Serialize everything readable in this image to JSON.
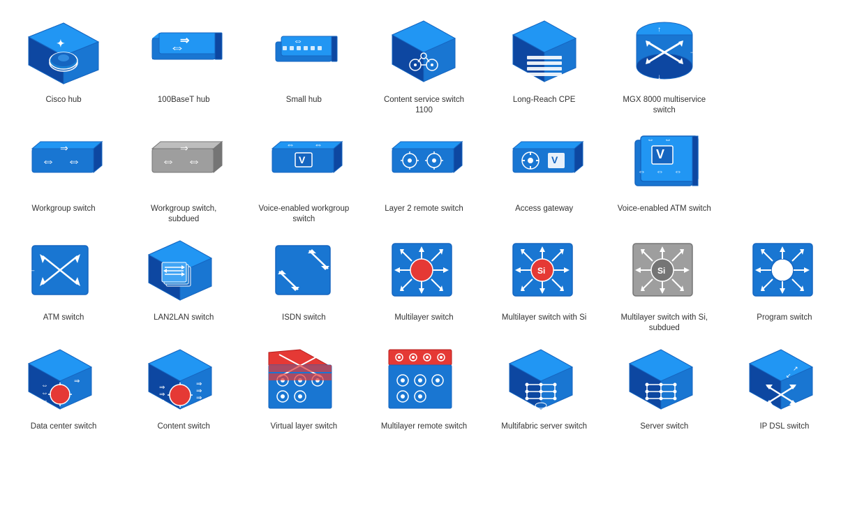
{
  "items": [
    {
      "id": "cisco-hub",
      "label": "Cisco hub",
      "type": "cisco-hub"
    },
    {
      "id": "100baset-hub",
      "label": "100BaseT hub",
      "type": "100baset-hub"
    },
    {
      "id": "small-hub",
      "label": "Small hub",
      "type": "small-hub"
    },
    {
      "id": "content-service-switch-1100",
      "label": "Content service switch 1100",
      "type": "content-service-switch"
    },
    {
      "id": "long-reach-cpe",
      "label": "Long-Reach CPE",
      "type": "long-reach-cpe"
    },
    {
      "id": "mgx-8000",
      "label": "MGX 8000 multiservice switch",
      "type": "mgx-8000"
    },
    {
      "id": "spacer1",
      "label": "",
      "type": "empty"
    },
    {
      "id": "workgroup-switch",
      "label": "Workgroup switch",
      "type": "workgroup-switch"
    },
    {
      "id": "workgroup-switch-subdued",
      "label": "Workgroup switch, subdued",
      "type": "workgroup-switch-subdued"
    },
    {
      "id": "voice-workgroup-switch",
      "label": "Voice-enabled workgroup switch",
      "type": "voice-workgroup-switch"
    },
    {
      "id": "layer2-remote-switch",
      "label": "Layer 2 remote switch",
      "type": "layer2-remote-switch"
    },
    {
      "id": "access-gateway",
      "label": "Access gateway",
      "type": "access-gateway"
    },
    {
      "id": "voice-atm-switch",
      "label": "Voice-enabled ATM switch",
      "type": "voice-atm-switch"
    },
    {
      "id": "spacer2",
      "label": "",
      "type": "empty"
    },
    {
      "id": "atm-switch",
      "label": "ATM switch",
      "type": "atm-switch"
    },
    {
      "id": "lan2lan-switch",
      "label": "LAN2LAN switch",
      "type": "lan2lan-switch"
    },
    {
      "id": "isdn-switch",
      "label": "ISDN switch",
      "type": "isdn-switch"
    },
    {
      "id": "multilayer-switch",
      "label": "Multilayer switch",
      "type": "multilayer-switch"
    },
    {
      "id": "multilayer-switch-si",
      "label": "Multilayer switch with Si",
      "type": "multilayer-switch-si"
    },
    {
      "id": "multilayer-switch-si-subdued",
      "label": "Multilayer switch with Si, subdued",
      "type": "multilayer-switch-si-subdued"
    },
    {
      "id": "program-switch",
      "label": "Program switch",
      "type": "program-switch"
    },
    {
      "id": "data-center-switch",
      "label": "Data center switch",
      "type": "data-center-switch"
    },
    {
      "id": "content-switch",
      "label": "Content switch",
      "type": "content-switch"
    },
    {
      "id": "virtual-layer-switch",
      "label": "Virtual layer switch",
      "type": "virtual-layer-switch"
    },
    {
      "id": "multilayer-remote-switch",
      "label": "Multilayer remote switch",
      "type": "multilayer-remote-switch"
    },
    {
      "id": "multifabric-server-switch",
      "label": "Multifabric server switch",
      "type": "multifabric-server-switch"
    },
    {
      "id": "server-switch",
      "label": "Server switch",
      "type": "server-switch"
    },
    {
      "id": "ip-dsl-switch",
      "label": "IP DSL switch",
      "type": "ip-dsl-switch"
    }
  ],
  "colors": {
    "blue": "#1a7fd4",
    "blue_dark": "#1565c0",
    "blue_light": "#42a5f5",
    "blue_face": "#1976d2",
    "blue_top": "#2196f3",
    "blue_side": "#0d47a1",
    "gray": "#9e9e9e",
    "gray_dark": "#757575",
    "gray_light": "#bdbdbd",
    "red": "#e53935",
    "white": "#ffffff"
  }
}
